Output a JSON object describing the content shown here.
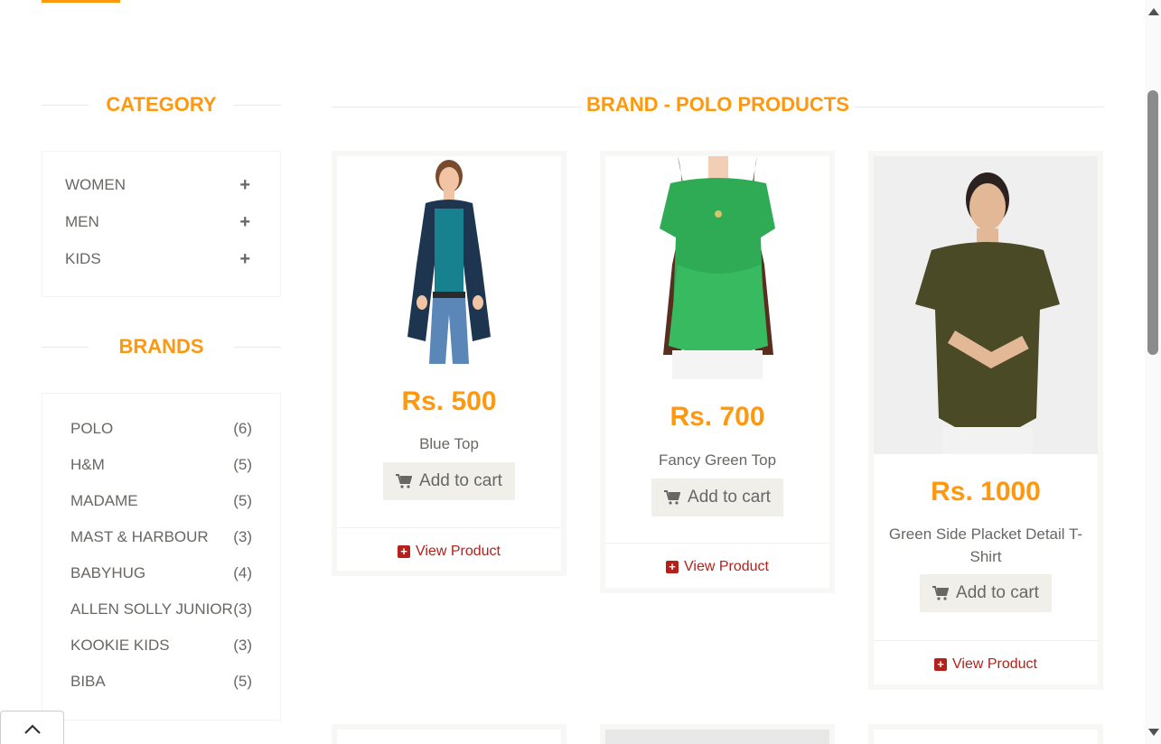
{
  "sidebar": {
    "category_title": "CATEGORY",
    "categories": [
      {
        "label": "WOMEN",
        "icon": "plus-icon"
      },
      {
        "label": "MEN",
        "icon": "plus-icon"
      },
      {
        "label": "KIDS",
        "icon": "plus-icon"
      }
    ],
    "brands_title": "BRANDS",
    "brands": [
      {
        "name": "POLO",
        "count": "(6)"
      },
      {
        "name": "H&M",
        "count": "(5)"
      },
      {
        "name": "MADAME",
        "count": "(5)"
      },
      {
        "name": "MAST & HARBOUR",
        "count": "(3)"
      },
      {
        "name": "BABYHUG",
        "count": "(4)"
      },
      {
        "name": "ALLEN SOLLY JUNIOR",
        "count": "(3)"
      },
      {
        "name": "KOOKIE KIDS",
        "count": "(3)"
      },
      {
        "name": "BIBA",
        "count": "(5)"
      }
    ]
  },
  "main": {
    "title": "BRAND - POLO PRODUCTS",
    "products": [
      {
        "price": "Rs. 500",
        "name": "Blue Top",
        "cart_label": "Add to cart",
        "view_label": "View Product"
      },
      {
        "price": "Rs. 700",
        "name": "Fancy Green Top",
        "cart_label": "Add to cart",
        "view_label": "View Product"
      },
      {
        "price": "Rs. 1000",
        "name": "Green Side Placket Detail T-Shirt",
        "cart_label": "Add to cart",
        "view_label": "View Product"
      }
    ]
  },
  "colors": {
    "accent": "#FE980F",
    "view_link": "#B4211A",
    "button_bg": "#F0EFEA"
  },
  "icons": {
    "cart": "shopping-cart-icon",
    "view": "plus-square-icon",
    "scroll_top": "chevron-up-icon"
  }
}
